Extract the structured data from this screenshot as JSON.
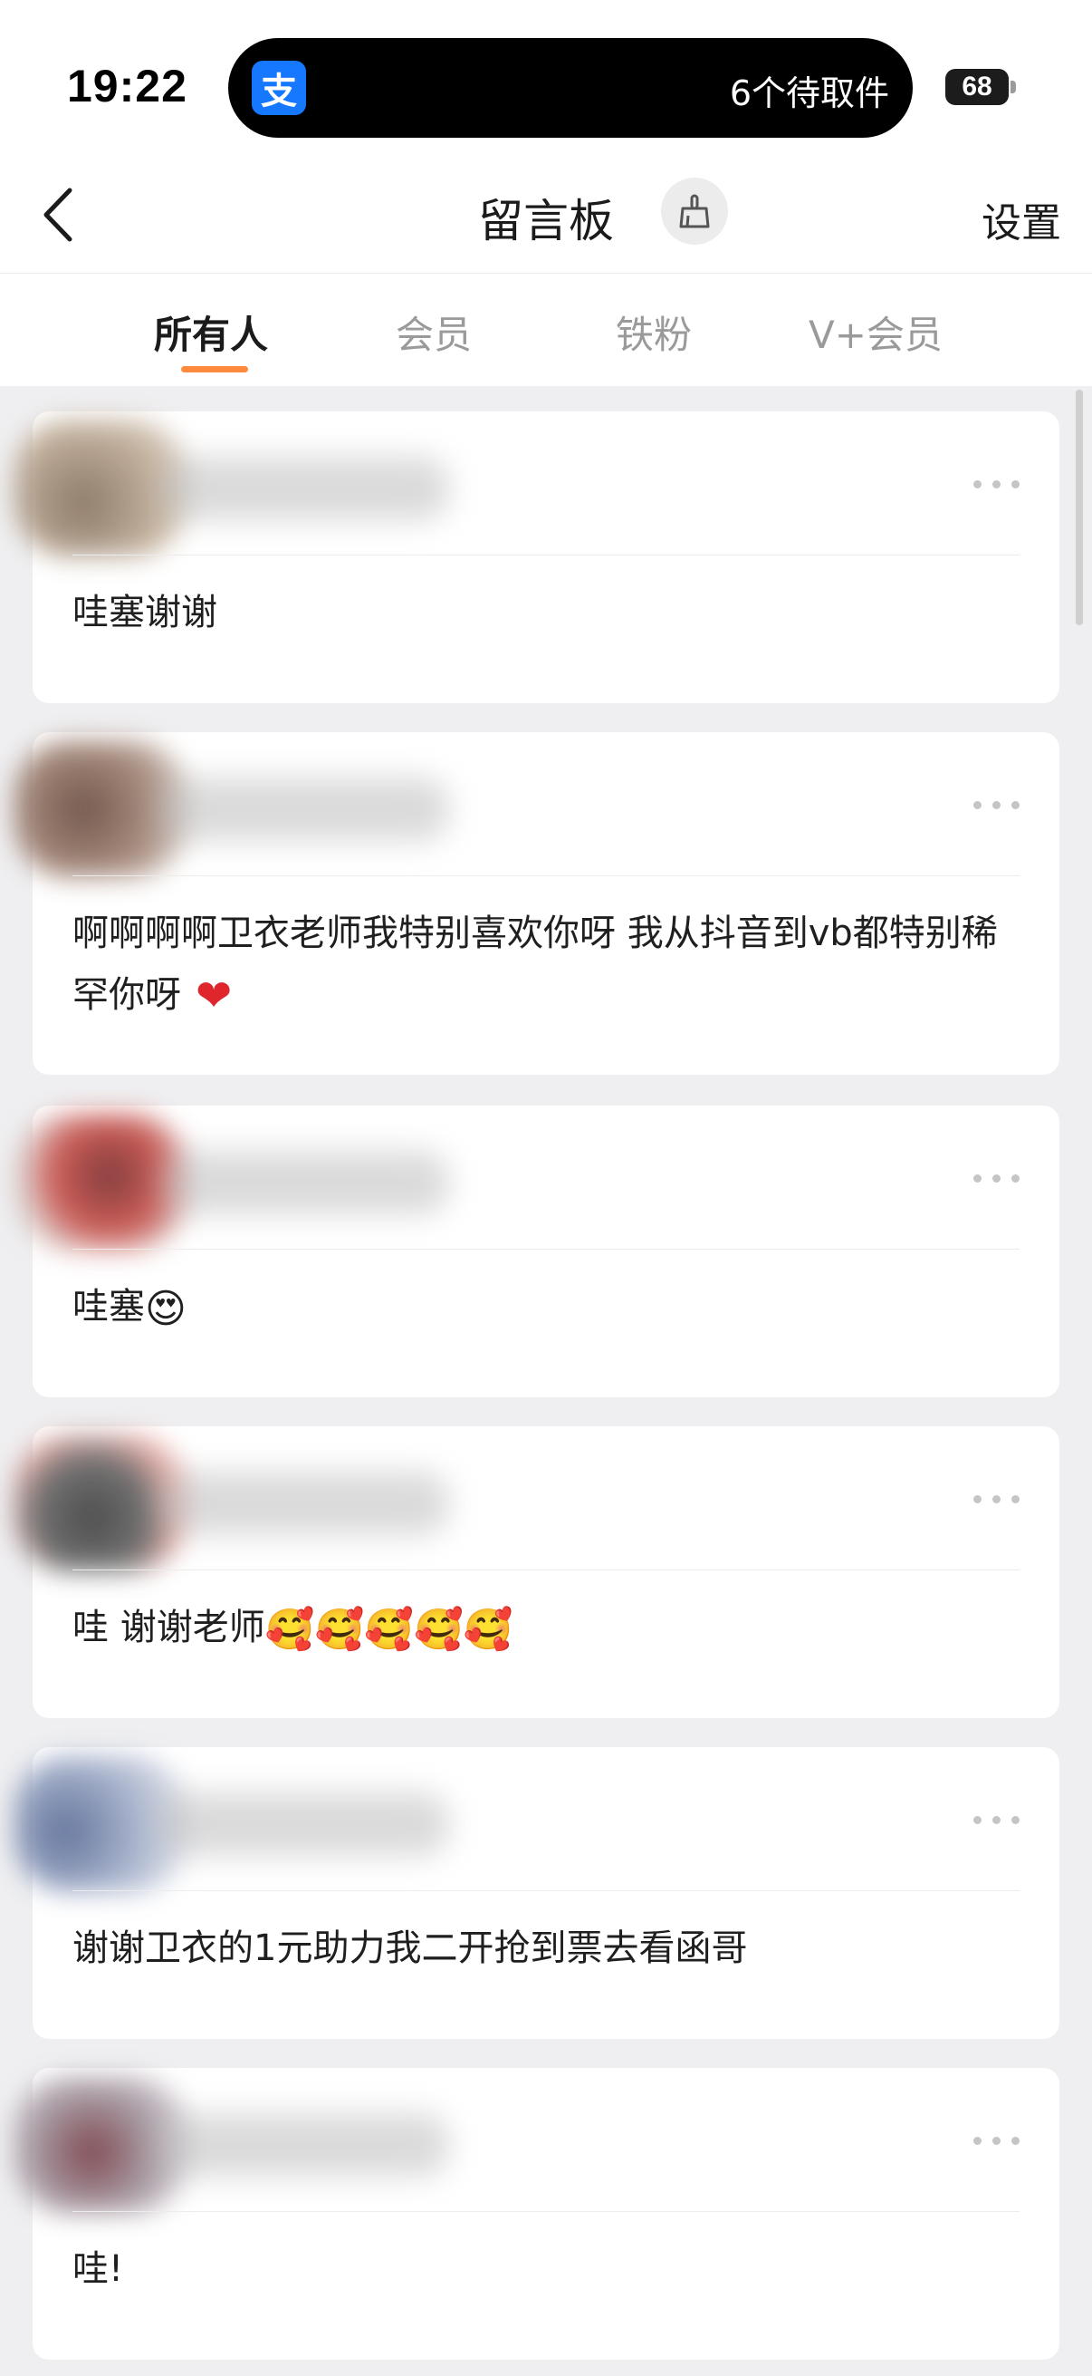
{
  "status_bar": {
    "time": "19:22",
    "app_badge": "支",
    "island_text": "6个待取件",
    "battery": "68"
  },
  "nav": {
    "title": "留言板",
    "settings": "设置",
    "back_icon": "chevron-left-icon",
    "clean_icon": "broom-icon"
  },
  "tabs": [
    {
      "label": "所有人",
      "active": true
    },
    {
      "label": "会员",
      "active": false
    },
    {
      "label": "铁粉",
      "active": false
    },
    {
      "label": "V+会员",
      "active": false
    }
  ],
  "colors": {
    "accent": "#ff8a3d",
    "heart": "#e0262d",
    "app_blue": "#1677ff"
  },
  "comments": [
    {
      "text": "哇塞谢谢",
      "emojis": ""
    },
    {
      "text": "啊啊啊啊卫衣老师我特别喜欢你呀 我从抖音到vb都特别稀罕你呀",
      "emojis": "❤"
    },
    {
      "text": "哇塞",
      "emojis": "😍"
    },
    {
      "text": "哇 谢谢老师",
      "emojis": "🥰🥰🥰🥰🥰"
    },
    {
      "text": "谢谢卫衣的1元助力我二开抢到票去看函哥",
      "emojis": ""
    },
    {
      "text": "哇!",
      "emojis": ""
    }
  ]
}
